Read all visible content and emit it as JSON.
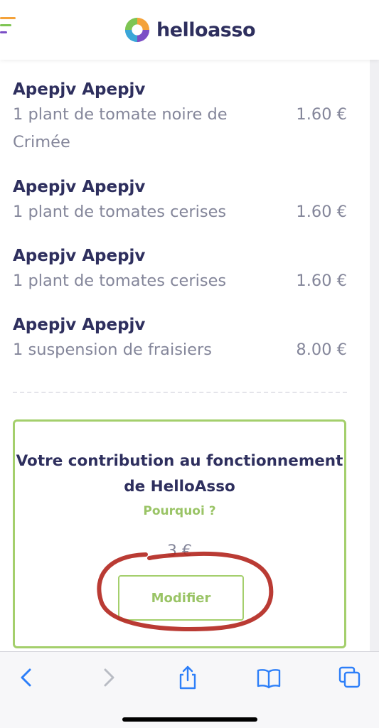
{
  "header": {
    "logo_text": "helloasso",
    "icons": {
      "menu": "hamburger-menu-icon",
      "logo": "helloasso-logo-icon"
    },
    "colors": {
      "brand_navy": "#2e2f5e",
      "logo_orange": "#f4a23a",
      "logo_purple": "#7b4fc6",
      "logo_green": "#7ec553"
    }
  },
  "items": [
    {
      "name": "Apepjv Apepjv",
      "description": "1 plant de tomate noire de Crimée",
      "price": "1.60 €"
    },
    {
      "name": "Apepjv Apepjv",
      "description": "1 plant de tomates cerises",
      "price": "1.60 €"
    },
    {
      "name": "Apepjv Apepjv",
      "description": "1 plant de tomates cerises",
      "price": "1.60 €"
    },
    {
      "name": "Apepjv Apepjv",
      "description": "1 suspension de fraisiers",
      "price": "8.00 €"
    }
  ],
  "contribution": {
    "title": "Votre contribution au fonctionnement de HelloAsso",
    "why_link": "Pourquoi ?",
    "amount": "3 €",
    "modify_label": "Modifier",
    "colors": {
      "accent_green": "#a4cf6c",
      "annotation_red": "#b3261e"
    }
  },
  "toolbar": {
    "icons": [
      "back-icon",
      "forward-icon",
      "share-icon",
      "bookmarks-icon",
      "tabs-icon"
    ],
    "colors": {
      "active_blue": "#2d7ff9",
      "disabled_gray": "#b9bcc4"
    }
  }
}
